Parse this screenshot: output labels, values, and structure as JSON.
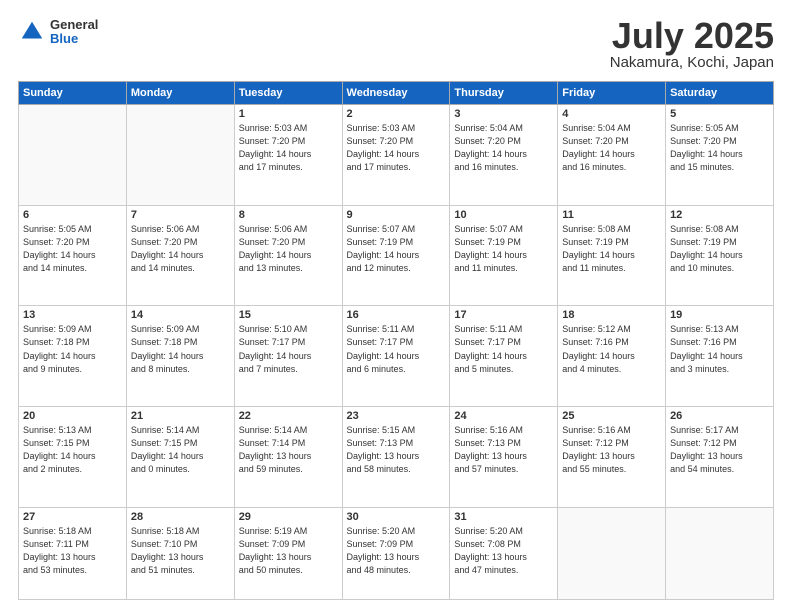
{
  "header": {
    "logo": {
      "general": "General",
      "blue": "Blue"
    },
    "title": "July 2025",
    "location": "Nakamura, Kochi, Japan"
  },
  "weekdays": [
    "Sunday",
    "Monday",
    "Tuesday",
    "Wednesday",
    "Thursday",
    "Friday",
    "Saturday"
  ],
  "weeks": [
    [
      {
        "day": "",
        "info": ""
      },
      {
        "day": "",
        "info": ""
      },
      {
        "day": "1",
        "info": "Sunrise: 5:03 AM\nSunset: 7:20 PM\nDaylight: 14 hours\nand 17 minutes."
      },
      {
        "day": "2",
        "info": "Sunrise: 5:03 AM\nSunset: 7:20 PM\nDaylight: 14 hours\nand 17 minutes."
      },
      {
        "day": "3",
        "info": "Sunrise: 5:04 AM\nSunset: 7:20 PM\nDaylight: 14 hours\nand 16 minutes."
      },
      {
        "day": "4",
        "info": "Sunrise: 5:04 AM\nSunset: 7:20 PM\nDaylight: 14 hours\nand 16 minutes."
      },
      {
        "day": "5",
        "info": "Sunrise: 5:05 AM\nSunset: 7:20 PM\nDaylight: 14 hours\nand 15 minutes."
      }
    ],
    [
      {
        "day": "6",
        "info": "Sunrise: 5:05 AM\nSunset: 7:20 PM\nDaylight: 14 hours\nand 14 minutes."
      },
      {
        "day": "7",
        "info": "Sunrise: 5:06 AM\nSunset: 7:20 PM\nDaylight: 14 hours\nand 14 minutes."
      },
      {
        "day": "8",
        "info": "Sunrise: 5:06 AM\nSunset: 7:20 PM\nDaylight: 14 hours\nand 13 minutes."
      },
      {
        "day": "9",
        "info": "Sunrise: 5:07 AM\nSunset: 7:19 PM\nDaylight: 14 hours\nand 12 minutes."
      },
      {
        "day": "10",
        "info": "Sunrise: 5:07 AM\nSunset: 7:19 PM\nDaylight: 14 hours\nand 11 minutes."
      },
      {
        "day": "11",
        "info": "Sunrise: 5:08 AM\nSunset: 7:19 PM\nDaylight: 14 hours\nand 11 minutes."
      },
      {
        "day": "12",
        "info": "Sunrise: 5:08 AM\nSunset: 7:19 PM\nDaylight: 14 hours\nand 10 minutes."
      }
    ],
    [
      {
        "day": "13",
        "info": "Sunrise: 5:09 AM\nSunset: 7:18 PM\nDaylight: 14 hours\nand 9 minutes."
      },
      {
        "day": "14",
        "info": "Sunrise: 5:09 AM\nSunset: 7:18 PM\nDaylight: 14 hours\nand 8 minutes."
      },
      {
        "day": "15",
        "info": "Sunrise: 5:10 AM\nSunset: 7:17 PM\nDaylight: 14 hours\nand 7 minutes."
      },
      {
        "day": "16",
        "info": "Sunrise: 5:11 AM\nSunset: 7:17 PM\nDaylight: 14 hours\nand 6 minutes."
      },
      {
        "day": "17",
        "info": "Sunrise: 5:11 AM\nSunset: 7:17 PM\nDaylight: 14 hours\nand 5 minutes."
      },
      {
        "day": "18",
        "info": "Sunrise: 5:12 AM\nSunset: 7:16 PM\nDaylight: 14 hours\nand 4 minutes."
      },
      {
        "day": "19",
        "info": "Sunrise: 5:13 AM\nSunset: 7:16 PM\nDaylight: 14 hours\nand 3 minutes."
      }
    ],
    [
      {
        "day": "20",
        "info": "Sunrise: 5:13 AM\nSunset: 7:15 PM\nDaylight: 14 hours\nand 2 minutes."
      },
      {
        "day": "21",
        "info": "Sunrise: 5:14 AM\nSunset: 7:15 PM\nDaylight: 14 hours\nand 0 minutes."
      },
      {
        "day": "22",
        "info": "Sunrise: 5:14 AM\nSunset: 7:14 PM\nDaylight: 13 hours\nand 59 minutes."
      },
      {
        "day": "23",
        "info": "Sunrise: 5:15 AM\nSunset: 7:13 PM\nDaylight: 13 hours\nand 58 minutes."
      },
      {
        "day": "24",
        "info": "Sunrise: 5:16 AM\nSunset: 7:13 PM\nDaylight: 13 hours\nand 57 minutes."
      },
      {
        "day": "25",
        "info": "Sunrise: 5:16 AM\nSunset: 7:12 PM\nDaylight: 13 hours\nand 55 minutes."
      },
      {
        "day": "26",
        "info": "Sunrise: 5:17 AM\nSunset: 7:12 PM\nDaylight: 13 hours\nand 54 minutes."
      }
    ],
    [
      {
        "day": "27",
        "info": "Sunrise: 5:18 AM\nSunset: 7:11 PM\nDaylight: 13 hours\nand 53 minutes."
      },
      {
        "day": "28",
        "info": "Sunrise: 5:18 AM\nSunset: 7:10 PM\nDaylight: 13 hours\nand 51 minutes."
      },
      {
        "day": "29",
        "info": "Sunrise: 5:19 AM\nSunset: 7:09 PM\nDaylight: 13 hours\nand 50 minutes."
      },
      {
        "day": "30",
        "info": "Sunrise: 5:20 AM\nSunset: 7:09 PM\nDaylight: 13 hours\nand 48 minutes."
      },
      {
        "day": "31",
        "info": "Sunrise: 5:20 AM\nSunset: 7:08 PM\nDaylight: 13 hours\nand 47 minutes."
      },
      {
        "day": "",
        "info": ""
      },
      {
        "day": "",
        "info": ""
      }
    ]
  ]
}
